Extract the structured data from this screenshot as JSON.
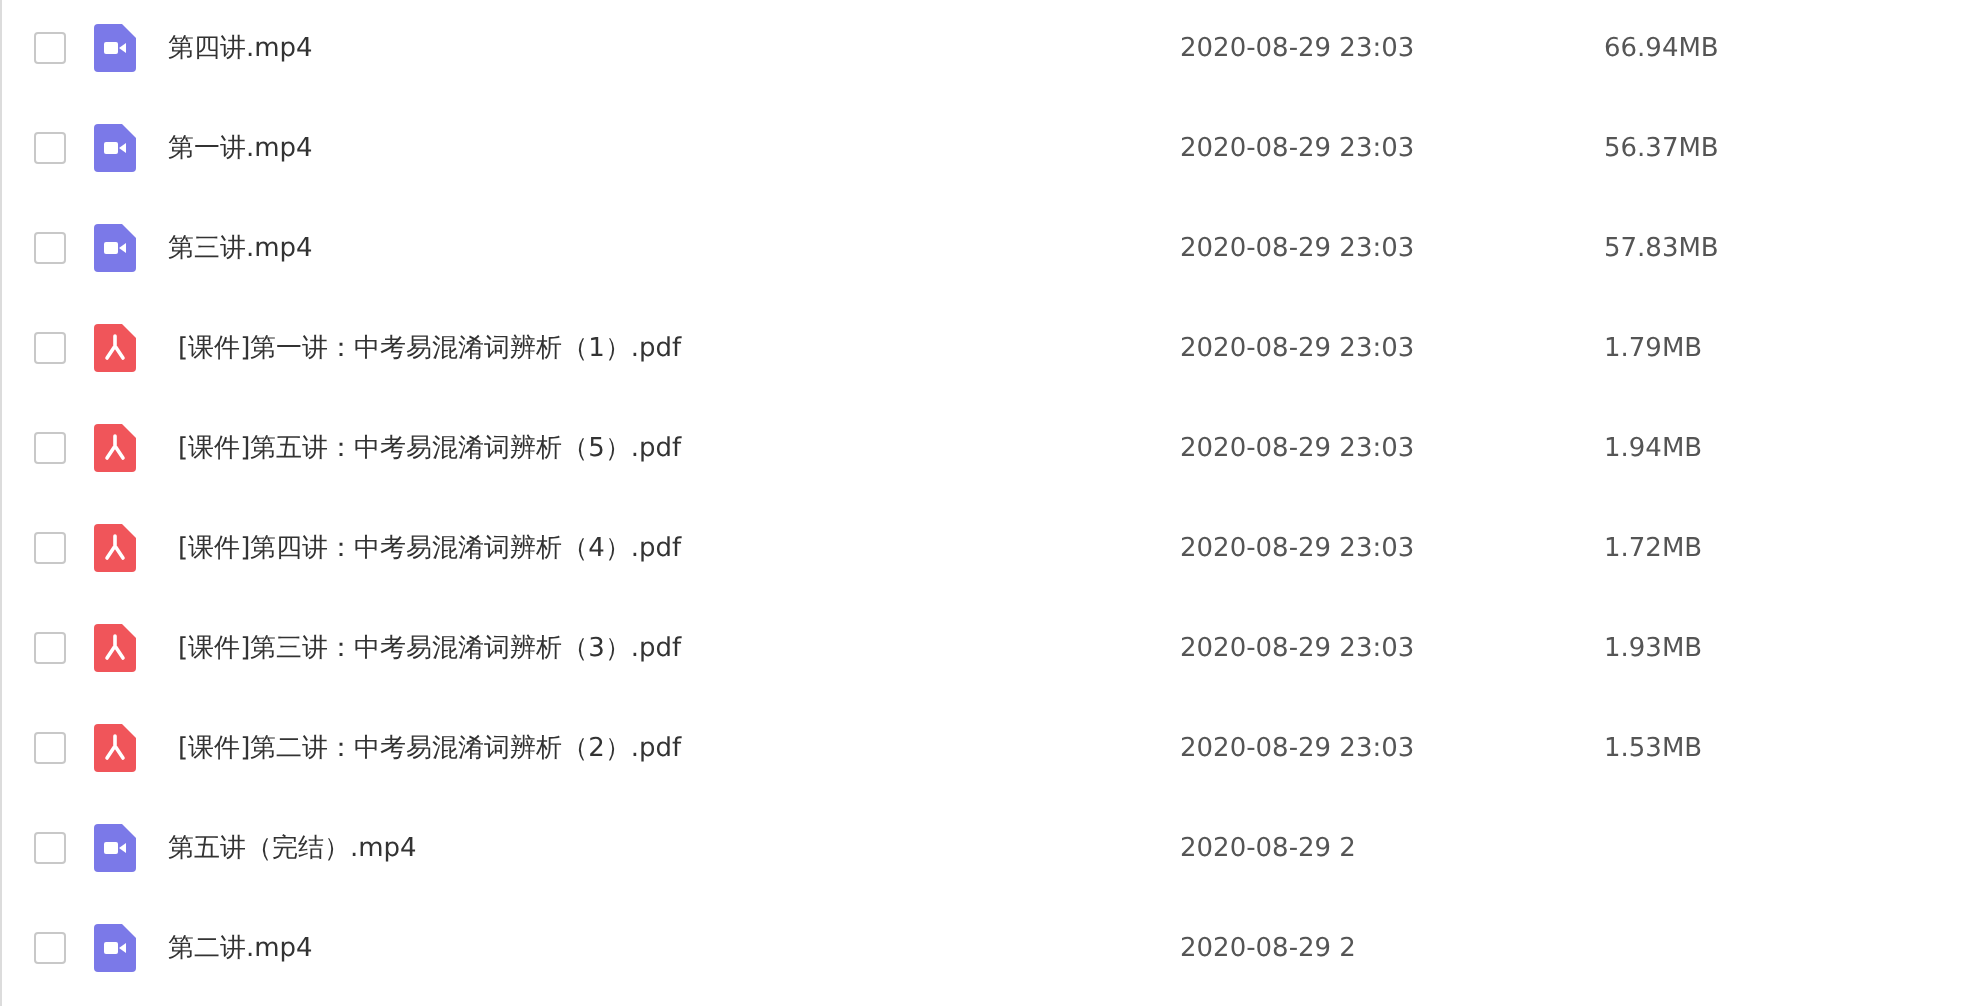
{
  "files": [
    {
      "kind": "video",
      "name": "第四讲.mp4",
      "checked": false,
      "date": "2020-08-29 23:03",
      "size": "66.94MB"
    },
    {
      "kind": "video",
      "name": "第一讲.mp4",
      "checked": false,
      "date": "2020-08-29 23:03",
      "size": "56.37MB"
    },
    {
      "kind": "video",
      "name": "第三讲.mp4",
      "checked": false,
      "date": "2020-08-29 23:03",
      "size": "57.83MB"
    },
    {
      "kind": "pdf",
      "name": "[课件]第一讲：中考易混淆词辨析（1）.pdf",
      "checked": false,
      "date": "2020-08-29 23:03",
      "size": "1.79MB"
    },
    {
      "kind": "pdf",
      "name": "[课件]第五讲：中考易混淆词辨析（5）.pdf",
      "checked": false,
      "date": "2020-08-29 23:03",
      "size": "1.94MB"
    },
    {
      "kind": "pdf",
      "name": "[课件]第四讲：中考易混淆词辨析（4）.pdf",
      "checked": false,
      "date": "2020-08-29 23:03",
      "size": "1.72MB"
    },
    {
      "kind": "pdf",
      "name": "[课件]第三讲：中考易混淆词辨析（3）.pdf",
      "checked": false,
      "date": "2020-08-29 23:03",
      "size": "1.93MB"
    },
    {
      "kind": "pdf",
      "name": "[课件]第二讲：中考易混淆词辨析（2）.pdf",
      "checked": false,
      "date": "2020-08-29 23:03",
      "size": "1.53MB"
    },
    {
      "kind": "video",
      "name": "第五讲（完结）.mp4",
      "checked": false,
      "date": "2020-08-29 2"
    },
    {
      "kind": "video",
      "name": "第二讲.mp4",
      "checked": false,
      "date": "2020-08-29 2"
    }
  ]
}
